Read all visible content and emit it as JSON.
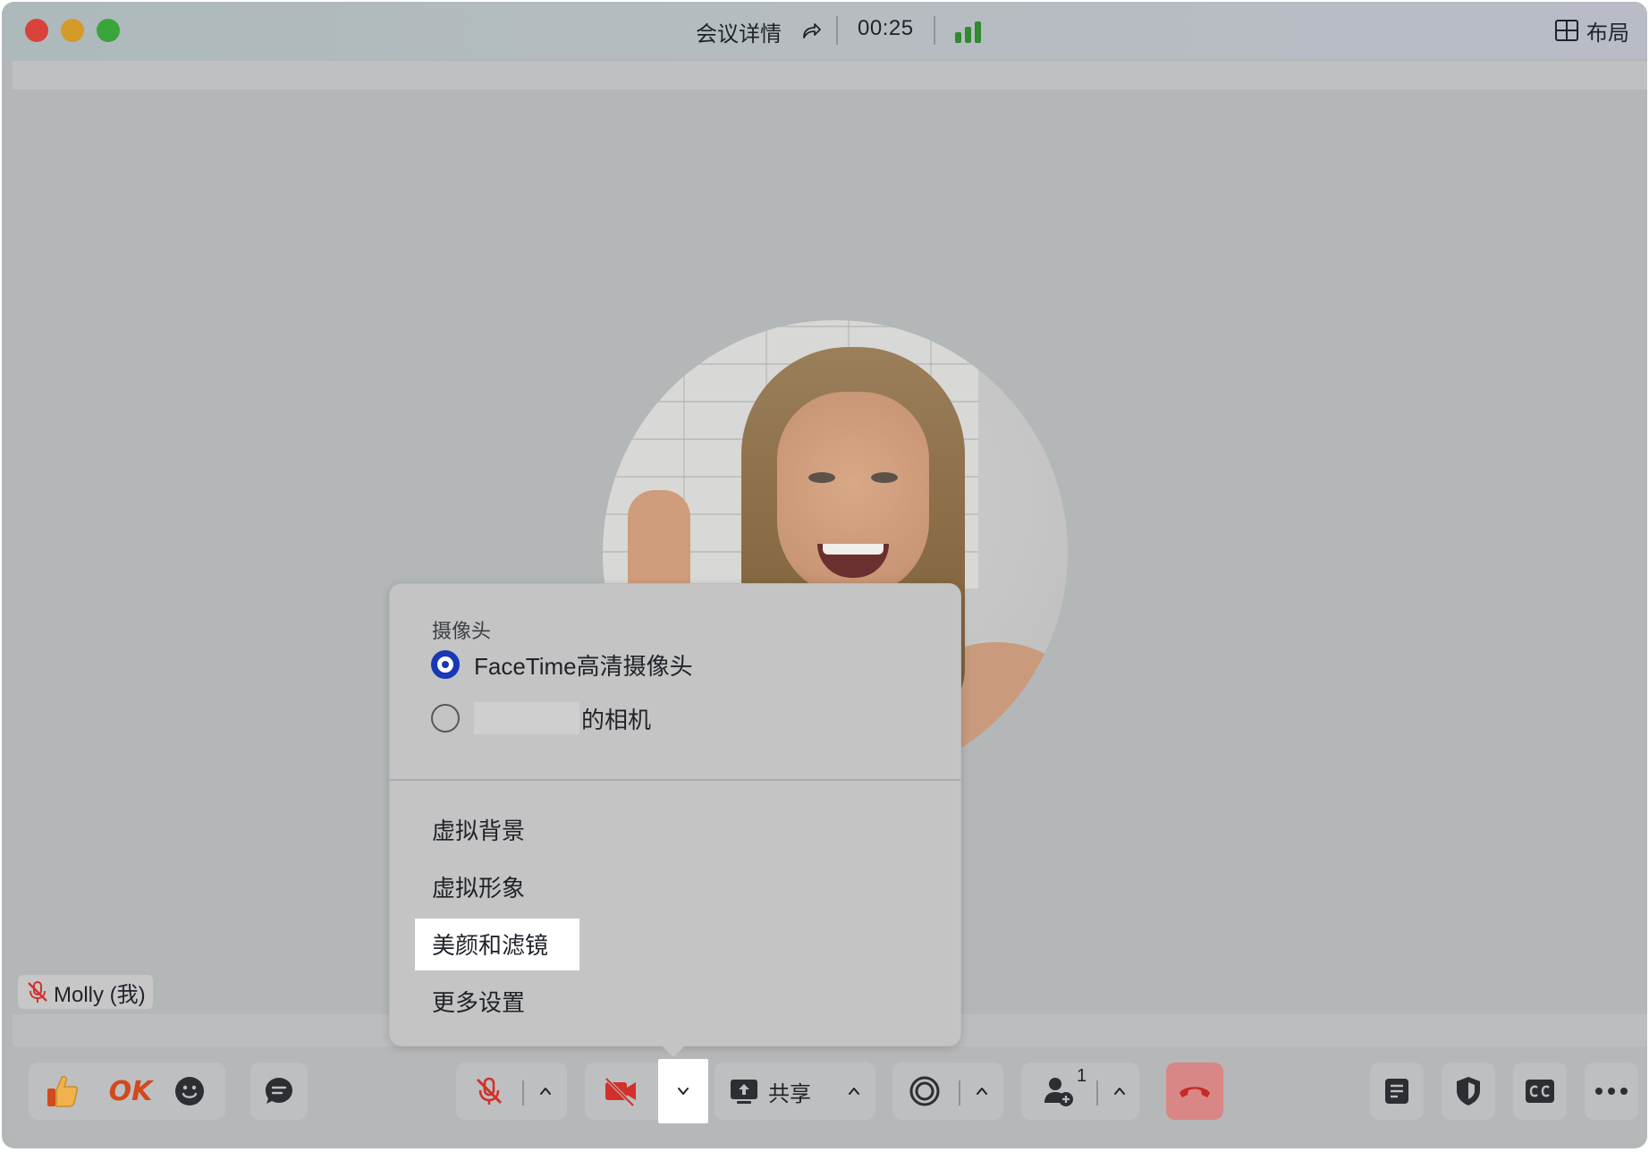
{
  "titlebar": {
    "title": "会议详情",
    "timer": "00:25",
    "layout_label": "布局"
  },
  "participant": {
    "self_label": "Molly (我)"
  },
  "camera_menu": {
    "heading": "摄像头",
    "options": [
      {
        "label": "FaceTime高清摄像头",
        "selected": true
      },
      {
        "label": "的相机",
        "selected": false
      }
    ],
    "items": [
      {
        "label": "虚拟背景"
      },
      {
        "label": "虚拟形象"
      },
      {
        "label": "美颜和滤镜",
        "highlighted": true
      },
      {
        "label": "更多设置"
      }
    ]
  },
  "toolbar": {
    "reaction_ok": "OK",
    "share_label": "共享",
    "participants_count": "1"
  },
  "colors": {
    "accent": "#1838b5",
    "signal": "#2e8b2e",
    "hangup": "#d98686"
  }
}
